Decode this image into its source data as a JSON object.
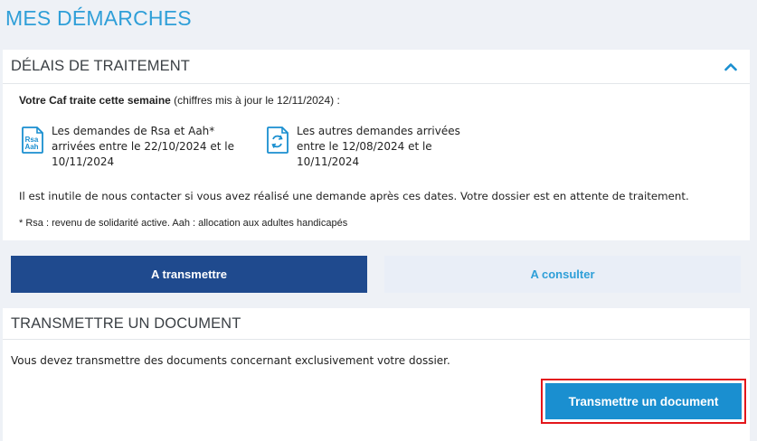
{
  "page": {
    "title": "MES DÉMARCHES"
  },
  "delais": {
    "title": "DÉLAIS DE TRAITEMENT",
    "intro_bold": "Votre Caf traite cette semaine",
    "intro_rest": " (chiffres mis à jour le 12/11/2024) :",
    "items": [
      {
        "icon": "rsa-aah-document-icon",
        "icon_line1": "Rsa",
        "icon_line2": "Aah",
        "text": "Les demandes de Rsa et Aah* arrivées entre le 22/10/2024 et le 10/11/2024"
      },
      {
        "icon": "refresh-document-icon",
        "text": "Les autres demandes arrivées entre le 12/08/2024 et le 10/11/2024"
      }
    ],
    "notice": "Il est inutile de nous contacter si vous avez réalisé une demande après ces dates. Votre dossier est en attente de traitement.",
    "footnote": "* Rsa : revenu de solidarité active. Aah : allocation aux adultes handicapés",
    "collapse_icon": "chevron-up-icon"
  },
  "tabs": [
    {
      "label": "A transmettre",
      "active": true
    },
    {
      "label": "A consulter",
      "active": false
    }
  ],
  "transmettre": {
    "title": "TRANSMETTRE UN DOCUMENT",
    "description": "Vous devez transmettre des documents concernant exclusivement votre dossier.",
    "button_label": "Transmettre un document"
  },
  "colors": {
    "title_blue": "#2f9fd8",
    "active_tab": "#1f4a8e",
    "inactive_tab_bg": "#e9eef7",
    "button_blue": "#1a8fd0",
    "highlight_red": "#e3161b",
    "background": "#eef1f6"
  }
}
